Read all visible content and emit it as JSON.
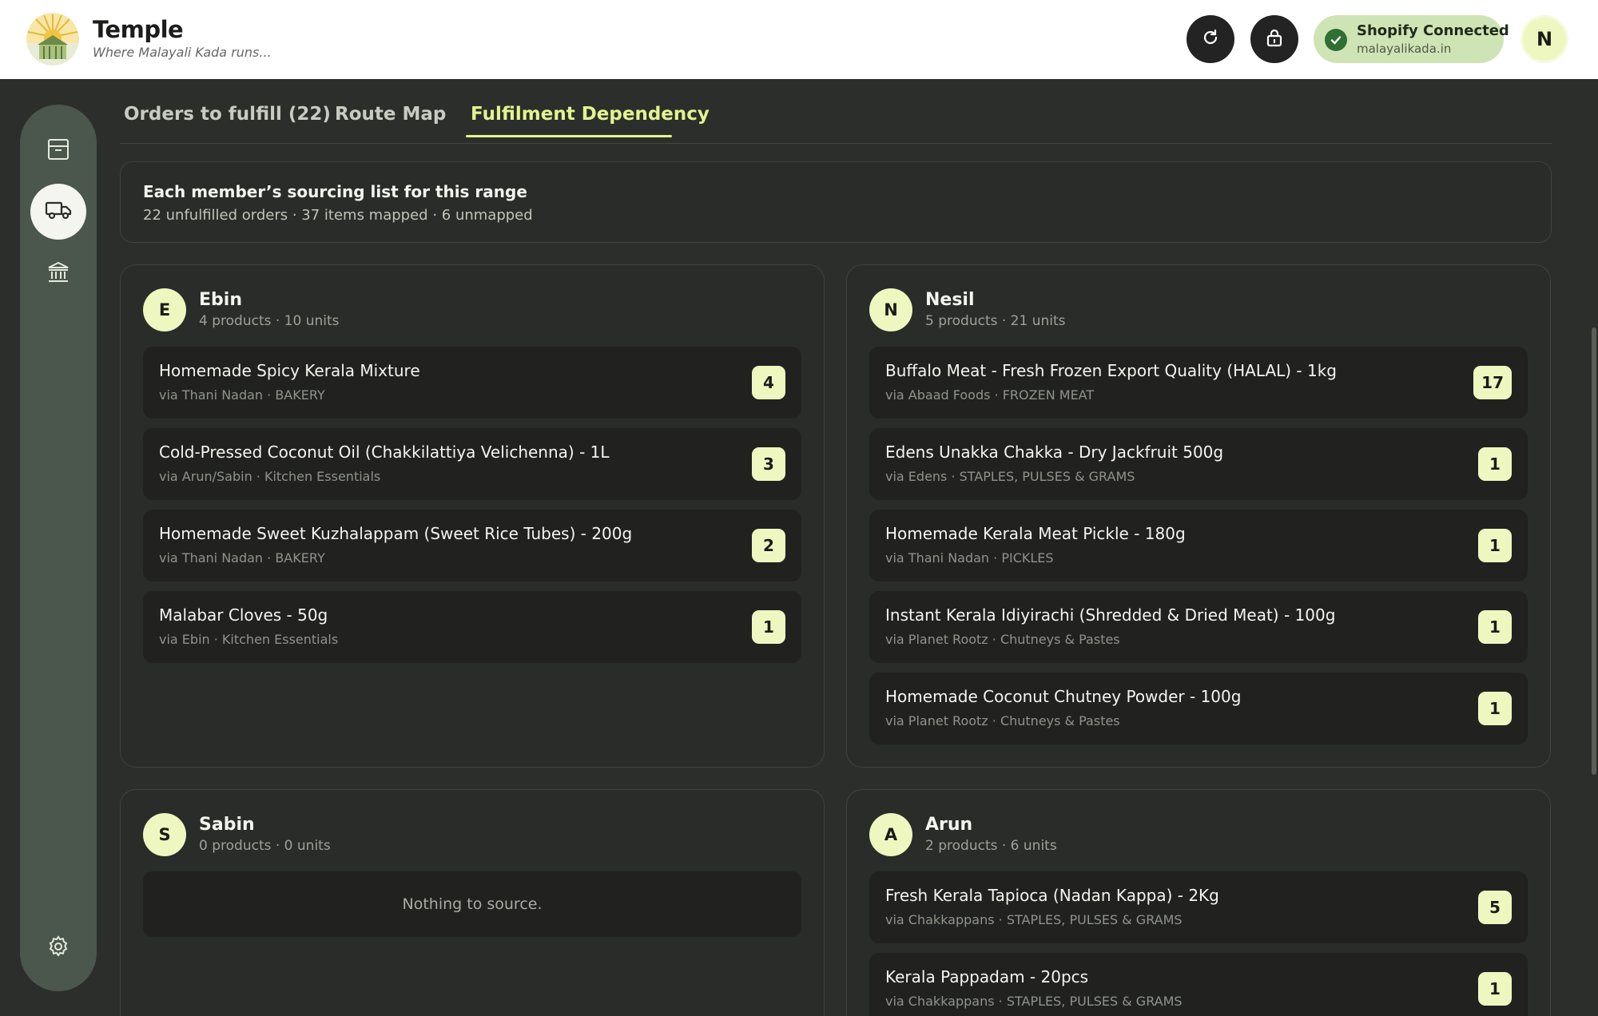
{
  "header": {
    "brand_title": "Temple",
    "brand_tagline": "Where Malayali Kada runs...",
    "refresh_icon": "refresh-icon",
    "lock_icon": "lock-icon",
    "shopify_status": "Shopify Connected",
    "shopify_store": "malayalikada.in",
    "user_initial": "N"
  },
  "sidebar": {
    "items": [
      {
        "icon": "archive-icon"
      },
      {
        "icon": "truck-icon",
        "active": true
      },
      {
        "icon": "bank-icon"
      },
      {
        "icon": "gear-icon"
      }
    ]
  },
  "tabs": [
    {
      "label": "Orders to fulfill (22)"
    },
    {
      "label": "Route Map"
    },
    {
      "label": "Fulfilment Dependency",
      "active": true
    }
  ],
  "summary": {
    "title": "Each member’s sourcing list for this range",
    "subtitle": "22 unfulfilled orders · 37 items mapped · 6 unmapped"
  },
  "members": [
    {
      "initial": "E",
      "name": "Ebin",
      "meta": "4 products · 10 units",
      "items": [
        {
          "name": "Homemade Spicy Kerala Mixture",
          "source": "via Thani Nadan · BAKERY",
          "qty": "4"
        },
        {
          "name": "Cold-Pressed Coconut Oil (Chakkilattiya Velichenna) - 1L",
          "source": "via Arun/Sabin · Kitchen Essentials",
          "qty": "3"
        },
        {
          "name": "Homemade Sweet Kuzhalappam (Sweet Rice Tubes) - 200g",
          "source": "via Thani Nadan · BAKERY",
          "qty": "2"
        },
        {
          "name": "Malabar Cloves - 50g",
          "source": "via Ebin · Kitchen Essentials",
          "qty": "1"
        }
      ]
    },
    {
      "initial": "N",
      "name": "Nesil",
      "meta": "5 products · 21 units",
      "items": [
        {
          "name": "Buffalo Meat - Fresh Frozen Export Quality (HALAL) - 1kg",
          "source": "via Abaad Foods · FROZEN MEAT",
          "qty": "17"
        },
        {
          "name": "Edens Unakka Chakka - Dry Jackfruit 500g",
          "source": "via Edens · STAPLES, PULSES & GRAMS",
          "qty": "1"
        },
        {
          "name": "Homemade Kerala Meat Pickle - 180g",
          "source": "via Thani Nadan · PICKLES",
          "qty": "1"
        },
        {
          "name": "Instant Kerala Idiyirachi (Shredded & Dried Meat) - 100g",
          "source": "via Planet Rootz · Chutneys & Pastes",
          "qty": "1"
        },
        {
          "name": "Homemade Coconut Chutney Powder - 100g",
          "source": "via Planet Rootz · Chutneys & Pastes",
          "qty": "1"
        }
      ]
    },
    {
      "initial": "S",
      "name": "Sabin",
      "meta": "0 products · 0 units",
      "empty_text": "Nothing to source."
    },
    {
      "initial": "A",
      "name": "Arun",
      "meta": "2 products · 6 units",
      "items": [
        {
          "name": "Fresh Kerala Tapioca (Nadan Kappa) - 2Kg",
          "source": "via Chakkappans · STAPLES, PULSES & GRAMS",
          "qty": "5"
        },
        {
          "name": "Kerala Pappadam - 20pcs",
          "source": "via Chakkappans · STAPLES, PULSES & GRAMS",
          "qty": "1"
        }
      ]
    }
  ],
  "colors": {
    "background": "#2c2e2b",
    "accent": "#e3f38f",
    "badge": "#eef7bf",
    "sidebar": "#4b574c",
    "shopify_pill": "#cfe4b4"
  }
}
